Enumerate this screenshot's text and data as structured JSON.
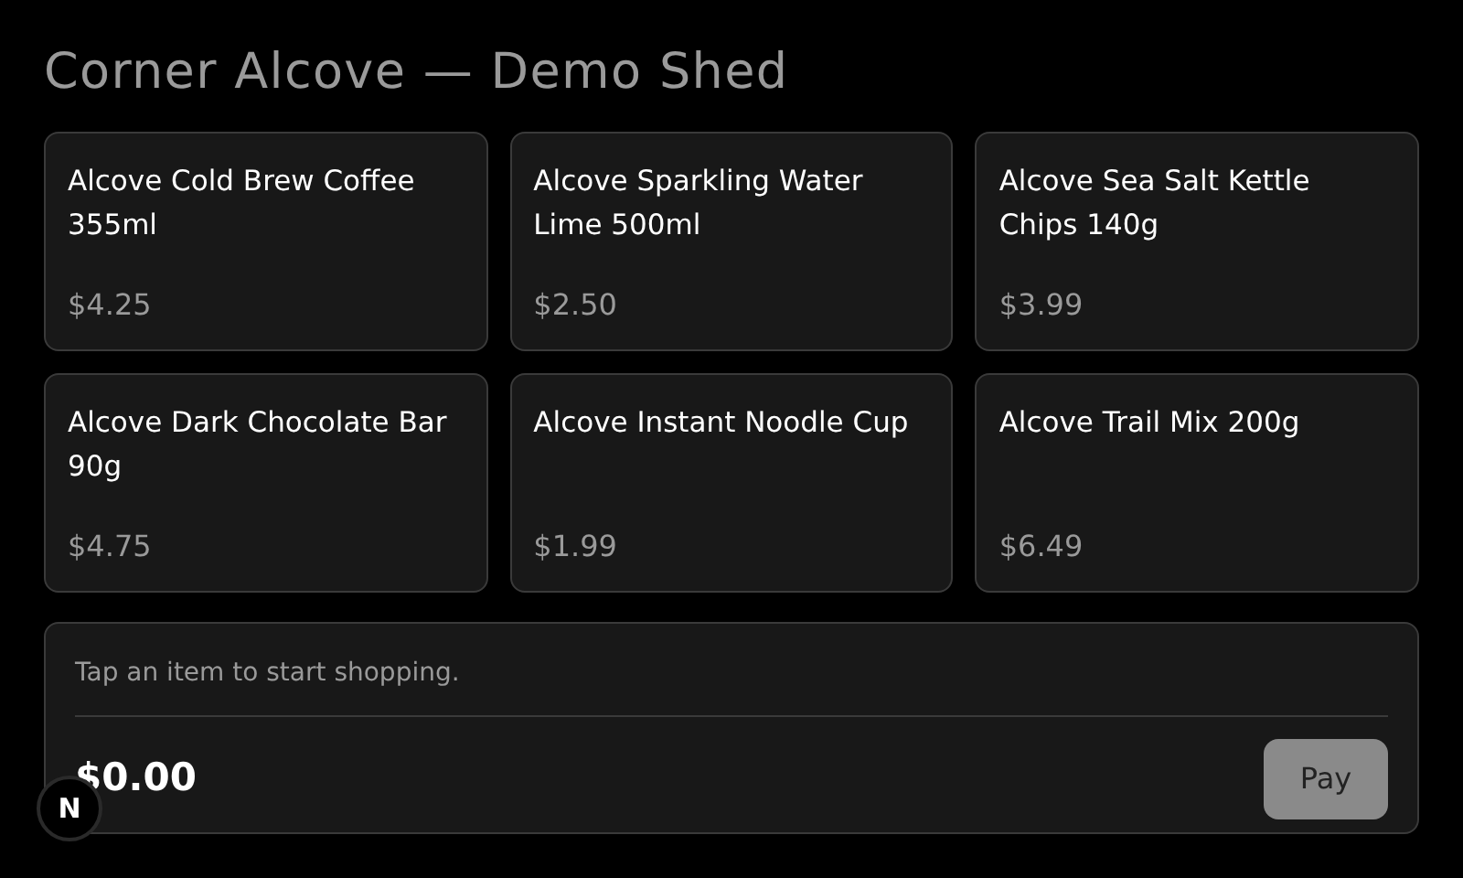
{
  "title": "Corner Alcove — Demo Shed",
  "products": [
    {
      "name": "Alcove Cold Brew Coffee 355ml",
      "price": "$4.25"
    },
    {
      "name": "Alcove Sparkling Water Lime 500ml",
      "price": "$2.50"
    },
    {
      "name": "Alcove Sea Salt Kettle Chips 140g",
      "price": "$3.99"
    },
    {
      "name": "Alcove Dark Chocolate Bar 90g",
      "price": "$4.75"
    },
    {
      "name": "Alcove Instant Noodle Cup",
      "price": "$1.99"
    },
    {
      "name": "Alcove Trail Mix 200g",
      "price": "$6.49"
    }
  ],
  "cart": {
    "message": "Tap an item to start shopping.",
    "total": "$0.00",
    "pay_button": {
      "label": "Pay",
      "disabled": true
    }
  },
  "dev_badge": {
    "label": "N"
  }
}
